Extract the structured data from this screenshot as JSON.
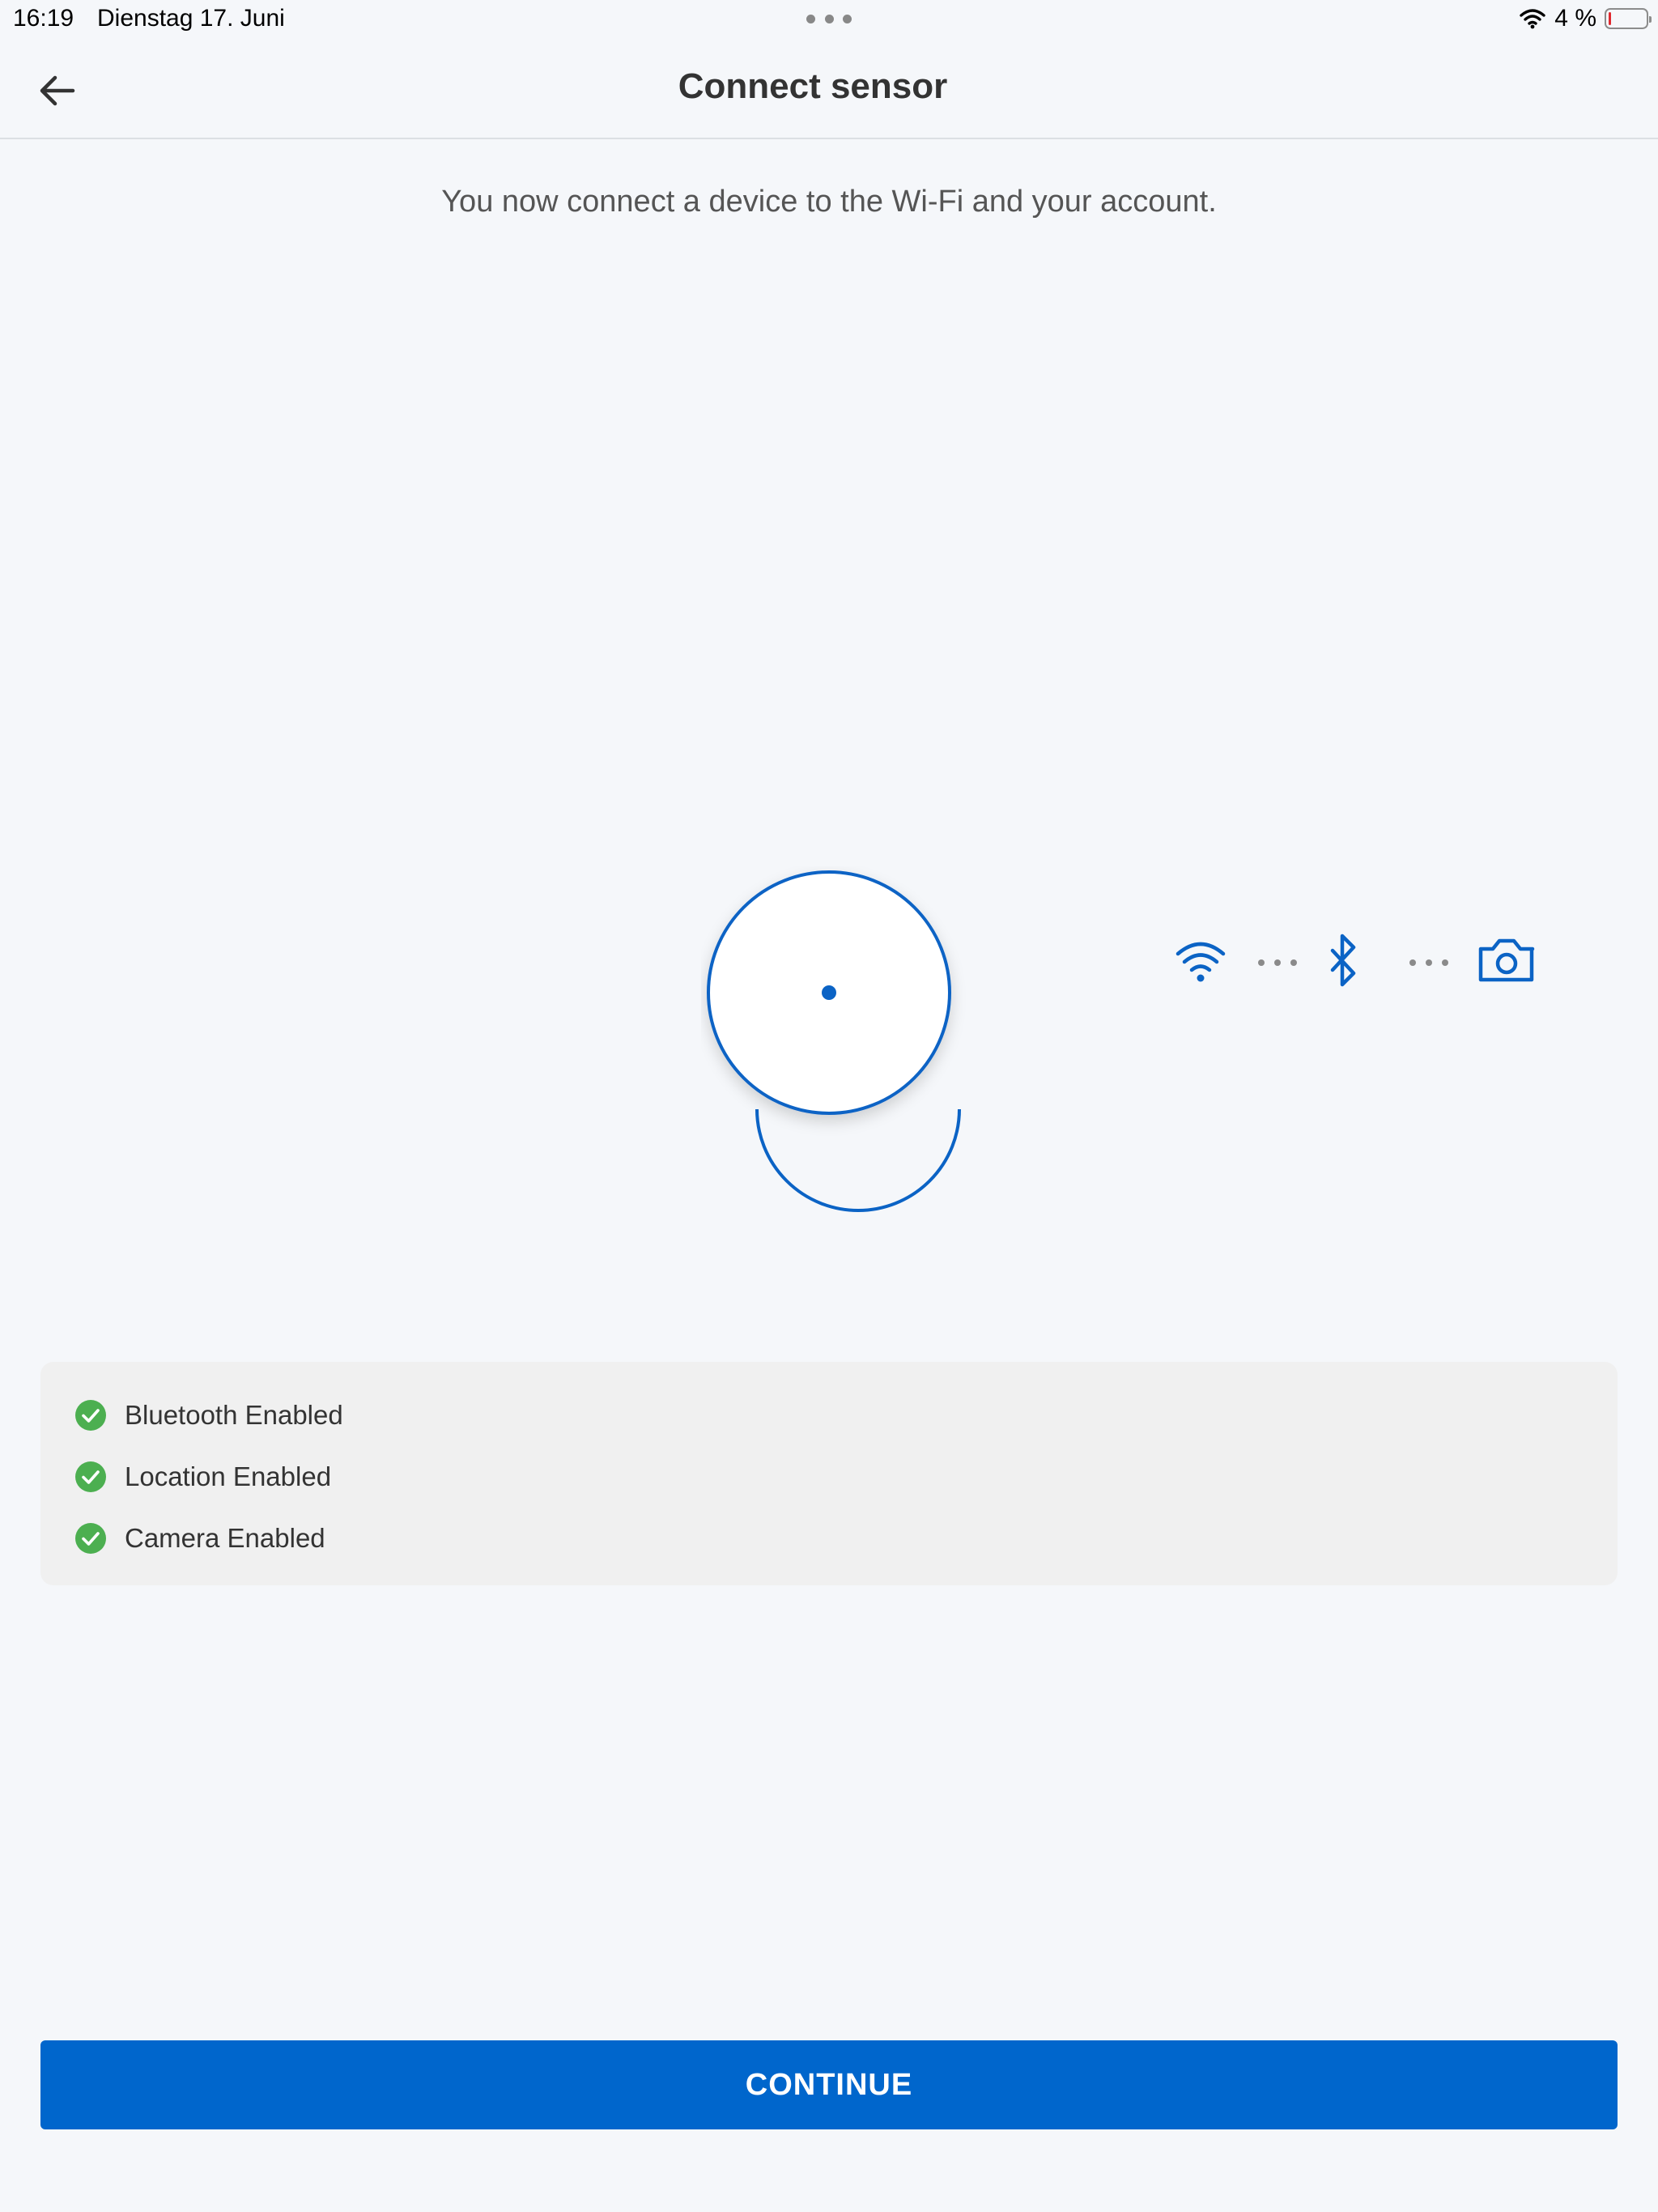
{
  "status_bar": {
    "time": "16:19",
    "date": "Dienstag 17. Juni",
    "battery_text": "4 %",
    "battery_level": 0.04,
    "battery_color": "#e0282e"
  },
  "header": {
    "back_icon": "arrow-left-icon",
    "title": "Connect sensor"
  },
  "intro_text": "You now connect a device to the Wi-Fi and your account.",
  "illustration": {
    "accent_color": "#0b63c5",
    "steps": [
      "wifi-icon",
      "bluetooth-icon",
      "camera-icon"
    ]
  },
  "permissions": [
    {
      "label": "Bluetooth Enabled",
      "status": "enabled"
    },
    {
      "label": "Location Enabled",
      "status": "enabled"
    },
    {
      "label": "Camera Enabled",
      "status": "enabled"
    }
  ],
  "check_color": "#4caf50",
  "footer": {
    "continue_label": "CONTINUE",
    "button_color": "#0066cc"
  }
}
